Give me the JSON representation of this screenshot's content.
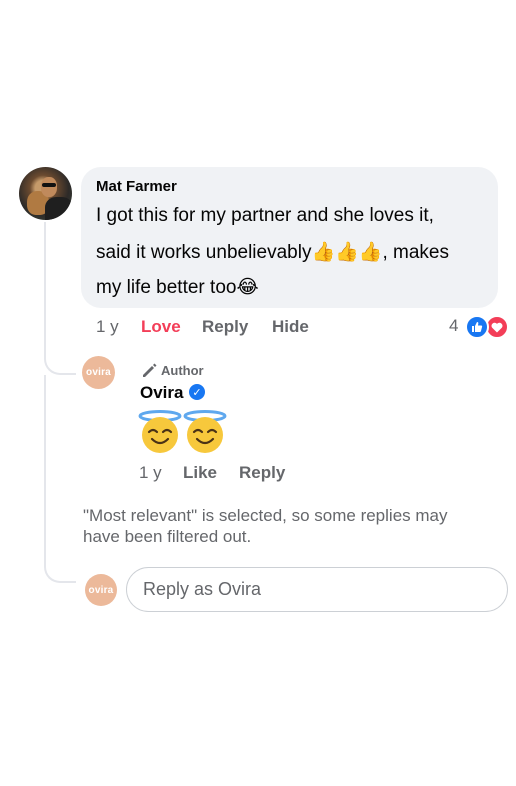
{
  "comment": {
    "author": "Mat Farmer",
    "lines": [
      "I got this for my partner and she loves it,",
      "said it works unbelievably",
      ", makes",
      "my life better too"
    ],
    "emojis": {
      "thumbs": "👍👍👍",
      "laugh": "😂"
    },
    "actions": {
      "time": "1 y",
      "love": "Love",
      "reply": "Reply",
      "hide": "Hide"
    },
    "reactions": {
      "count": "4",
      "icons": [
        "like-icon",
        "love-icon"
      ]
    }
  },
  "reply": {
    "avatar_text": "ovira",
    "badge": "Author",
    "author": "Ovira",
    "emoji_icons": [
      "smiling-face-with-halo-icon",
      "smiling-face-with-halo-icon"
    ],
    "actions": {
      "time": "1 y",
      "like": "Like",
      "reply": "Reply"
    }
  },
  "filter_notice": "\"Most relevant\" is selected, so some replies may have been filtered out.",
  "reply_box": {
    "avatar_text": "ovira",
    "placeholder": "Reply as Ovira"
  },
  "colors": {
    "bubble": "#f0f2f5",
    "love": "#f33e58",
    "like": "#1877f2",
    "muted_text": "#65676b",
    "brand_avatar": "#ecb99a"
  }
}
